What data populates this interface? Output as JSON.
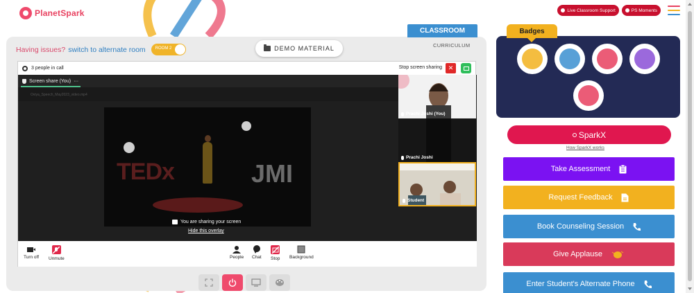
{
  "brand": {
    "logo_text": "PlanetSpark"
  },
  "header": {
    "live_support": "Live Classroom Support",
    "ps_moments": "PS Moments",
    "menu_colors": [
      "#e8405f",
      "#f2b11f",
      "#3b8fd0"
    ]
  },
  "issue_bar": {
    "label": "Having issues?",
    "link": "switch to alternate room",
    "toggle_label": "ROOM 2"
  },
  "demo_material": {
    "label": "DEMO MATERIAL"
  },
  "tabs": {
    "classroom": "CLASSROOM",
    "curriculum": "CURRICULUM"
  },
  "meeting": {
    "people_count": "3 people in call",
    "stop_sharing": "Stop screen sharing",
    "close_symbol": "✕",
    "screen_share_label": "Screen share (You)",
    "screen_share_more": "···",
    "file_name": "Oviya_Speech_May2023_video.mp4",
    "sharing_msg": "You are sharing your screen",
    "hide_overlay": "Hide this overlay",
    "video_text_left": "TEDx",
    "video_text_right": "JMI",
    "participants": [
      {
        "name": "Prachi Joshi (You)"
      },
      {
        "name": "Prachi Joshi"
      },
      {
        "name": "Student"
      }
    ],
    "controls": {
      "turn_off": "Turn off",
      "unmute": "Unmute",
      "people": "People",
      "chat": "Chat",
      "stop": "Stop",
      "background": "Background"
    }
  },
  "badges": {
    "title": "Badges",
    "items": [
      {
        "icon": "trophy-badge-icon",
        "color": "#f2b11f"
      },
      {
        "icon": "fist-badge-icon",
        "color": "#3b8fd0"
      },
      {
        "icon": "hero-badge-icon",
        "color": "#e8405f"
      },
      {
        "icon": "thinker-badge-icon",
        "color": "#8a4fd6"
      },
      {
        "icon": "robot-badge-icon",
        "color": "#e8405f"
      }
    ]
  },
  "sparkx": {
    "label": "SparkX",
    "how_link": "How SparkX works"
  },
  "actions": [
    {
      "label": "Take Assessment",
      "color": "#7b12f2",
      "icon": "clipboard-icon"
    },
    {
      "label": "Request Feedback",
      "color": "#f2b11f",
      "icon": "document-icon"
    },
    {
      "label": "Book Counseling Session",
      "color": "#3b8fd0",
      "icon": "phone-icon"
    },
    {
      "label": "Give Applause",
      "color": "#d93a5a",
      "icon": "clap-icon"
    },
    {
      "label": "Enter Student's Alternate Phone",
      "color": "#3b8fd0",
      "icon": "phone-icon"
    }
  ]
}
